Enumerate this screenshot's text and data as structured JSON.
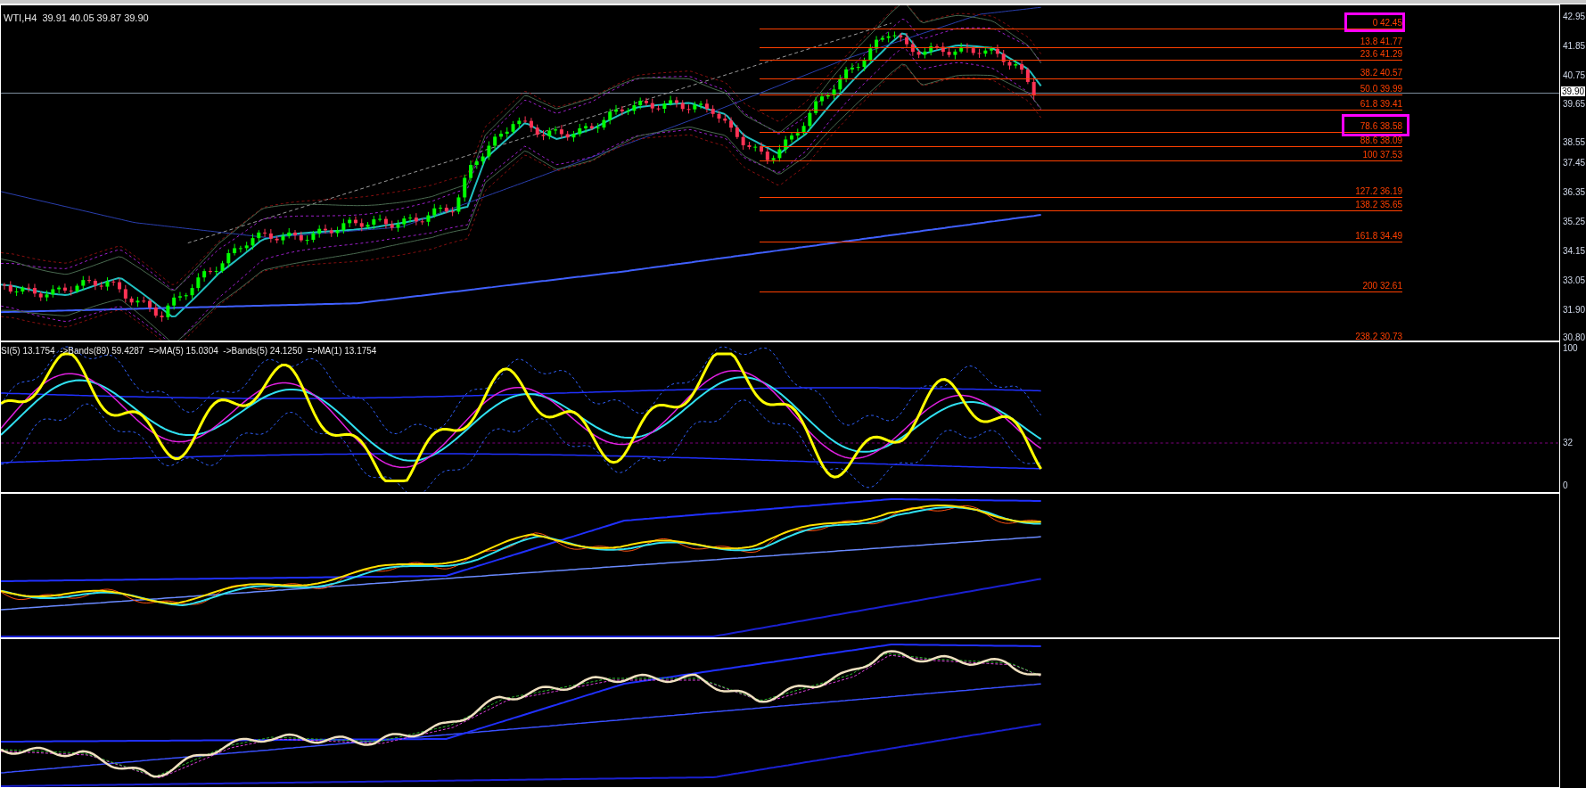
{
  "chart": {
    "symbol_info": "WTI,H4  39.91 40.05 39.87 39.90",
    "price_axis": [
      "42.95",
      "41.85",
      "40.75",
      "39.65",
      "38.55",
      "37.45",
      "36.35",
      "35.25",
      "34.15",
      "33.05",
      "31.90",
      "30.80"
    ],
    "current_price": "39.90",
    "fibonacci_levels": [
      "0 42.45",
      "13.8 41.77",
      "23.6 41.29",
      "38.2 40.57",
      "50.0 39.99",
      "61.8 39.41",
      "78.6 38.58",
      "88.6 38.09",
      "100 37.53",
      "127.2 36.19",
      "138.2 35.65",
      "161.8 34.49",
      "200 32.61",
      "238.2 30.73"
    ]
  },
  "rsi_window": {
    "label": "SI(5) 13.1754  ->Bands(89) 59.4287  =>MA(5) 15.0304  ->Bands(5) 24.1250  =>MA(1) 13.1754",
    "axis": [
      "100",
      "32",
      "0"
    ]
  }
}
